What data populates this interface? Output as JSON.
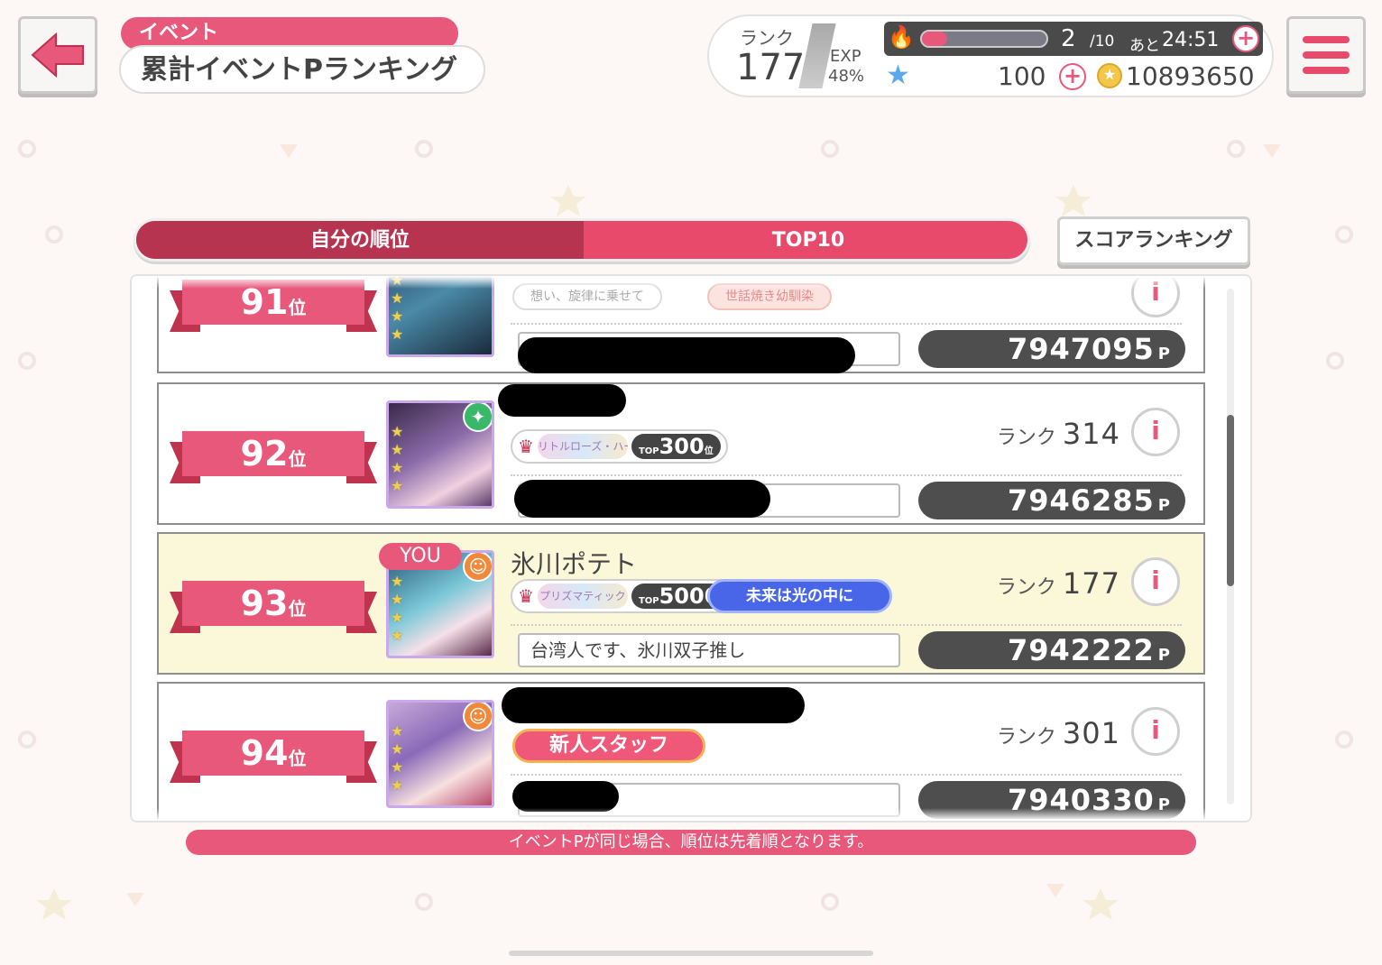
{
  "header": {
    "back_icon": "back-arrow-icon",
    "category": "イベント",
    "title": "累計イベントPランキング",
    "menu_icon": "hamburger-menu-icon"
  },
  "status": {
    "rank_label": "ランク",
    "rank_value": "177",
    "exp_label": "EXP",
    "exp_value": "48%",
    "stamina_current": "2",
    "stamina_max": "/10",
    "stamina_next_label": "あと",
    "stamina_next_time": "24:51",
    "stamina_fraction": 0.2,
    "star_count": "100",
    "coin_count": "10893650"
  },
  "tabs": {
    "mine": "自分の順位",
    "top10": "TOP10",
    "score_ranking": "スコアランキング"
  },
  "rows": [
    {
      "rank": "91",
      "rank_suffix": "位",
      "partial_badge_1": "想い、旋律に乗せて",
      "partial_badge_2": "世話焼き幼馴染",
      "points": "7947095",
      "points_unit": "P"
    },
    {
      "rank": "92",
      "rank_suffix": "位",
      "title_art": "リトルローズ・ハーモニー",
      "title_top_label": "TOP",
      "title_top": "300",
      "title_top_suffix": "位",
      "player_rank_label": "ランク",
      "player_rank": "314",
      "points": "7946285",
      "points_unit": "P"
    },
    {
      "rank": "93",
      "rank_suffix": "位",
      "you_label": "YOU",
      "name": "氷川ポテト",
      "title_art": "プリズマティック",
      "title_top_label": "TOP",
      "title_top": "5000",
      "title_top_suffix": "位",
      "degree": "未来は光の中に",
      "player_rank_label": "ランク",
      "player_rank": "177",
      "comment": "台湾人です、氷川双子推し",
      "points": "7942222",
      "points_unit": "P"
    },
    {
      "rank": "94",
      "rank_suffix": "位",
      "degree": "新人スタッフ",
      "player_rank_label": "ランク",
      "player_rank": "301",
      "points": "7940330",
      "points_unit": "P"
    }
  ],
  "footer_note": "イベントPが同じ場合、順位は先着順となります。",
  "colors": {
    "accent": "#e8587a",
    "tab_active": "#b73450",
    "highlight_row": "#fbf7d9",
    "points_bg": "#4e4e4e"
  }
}
